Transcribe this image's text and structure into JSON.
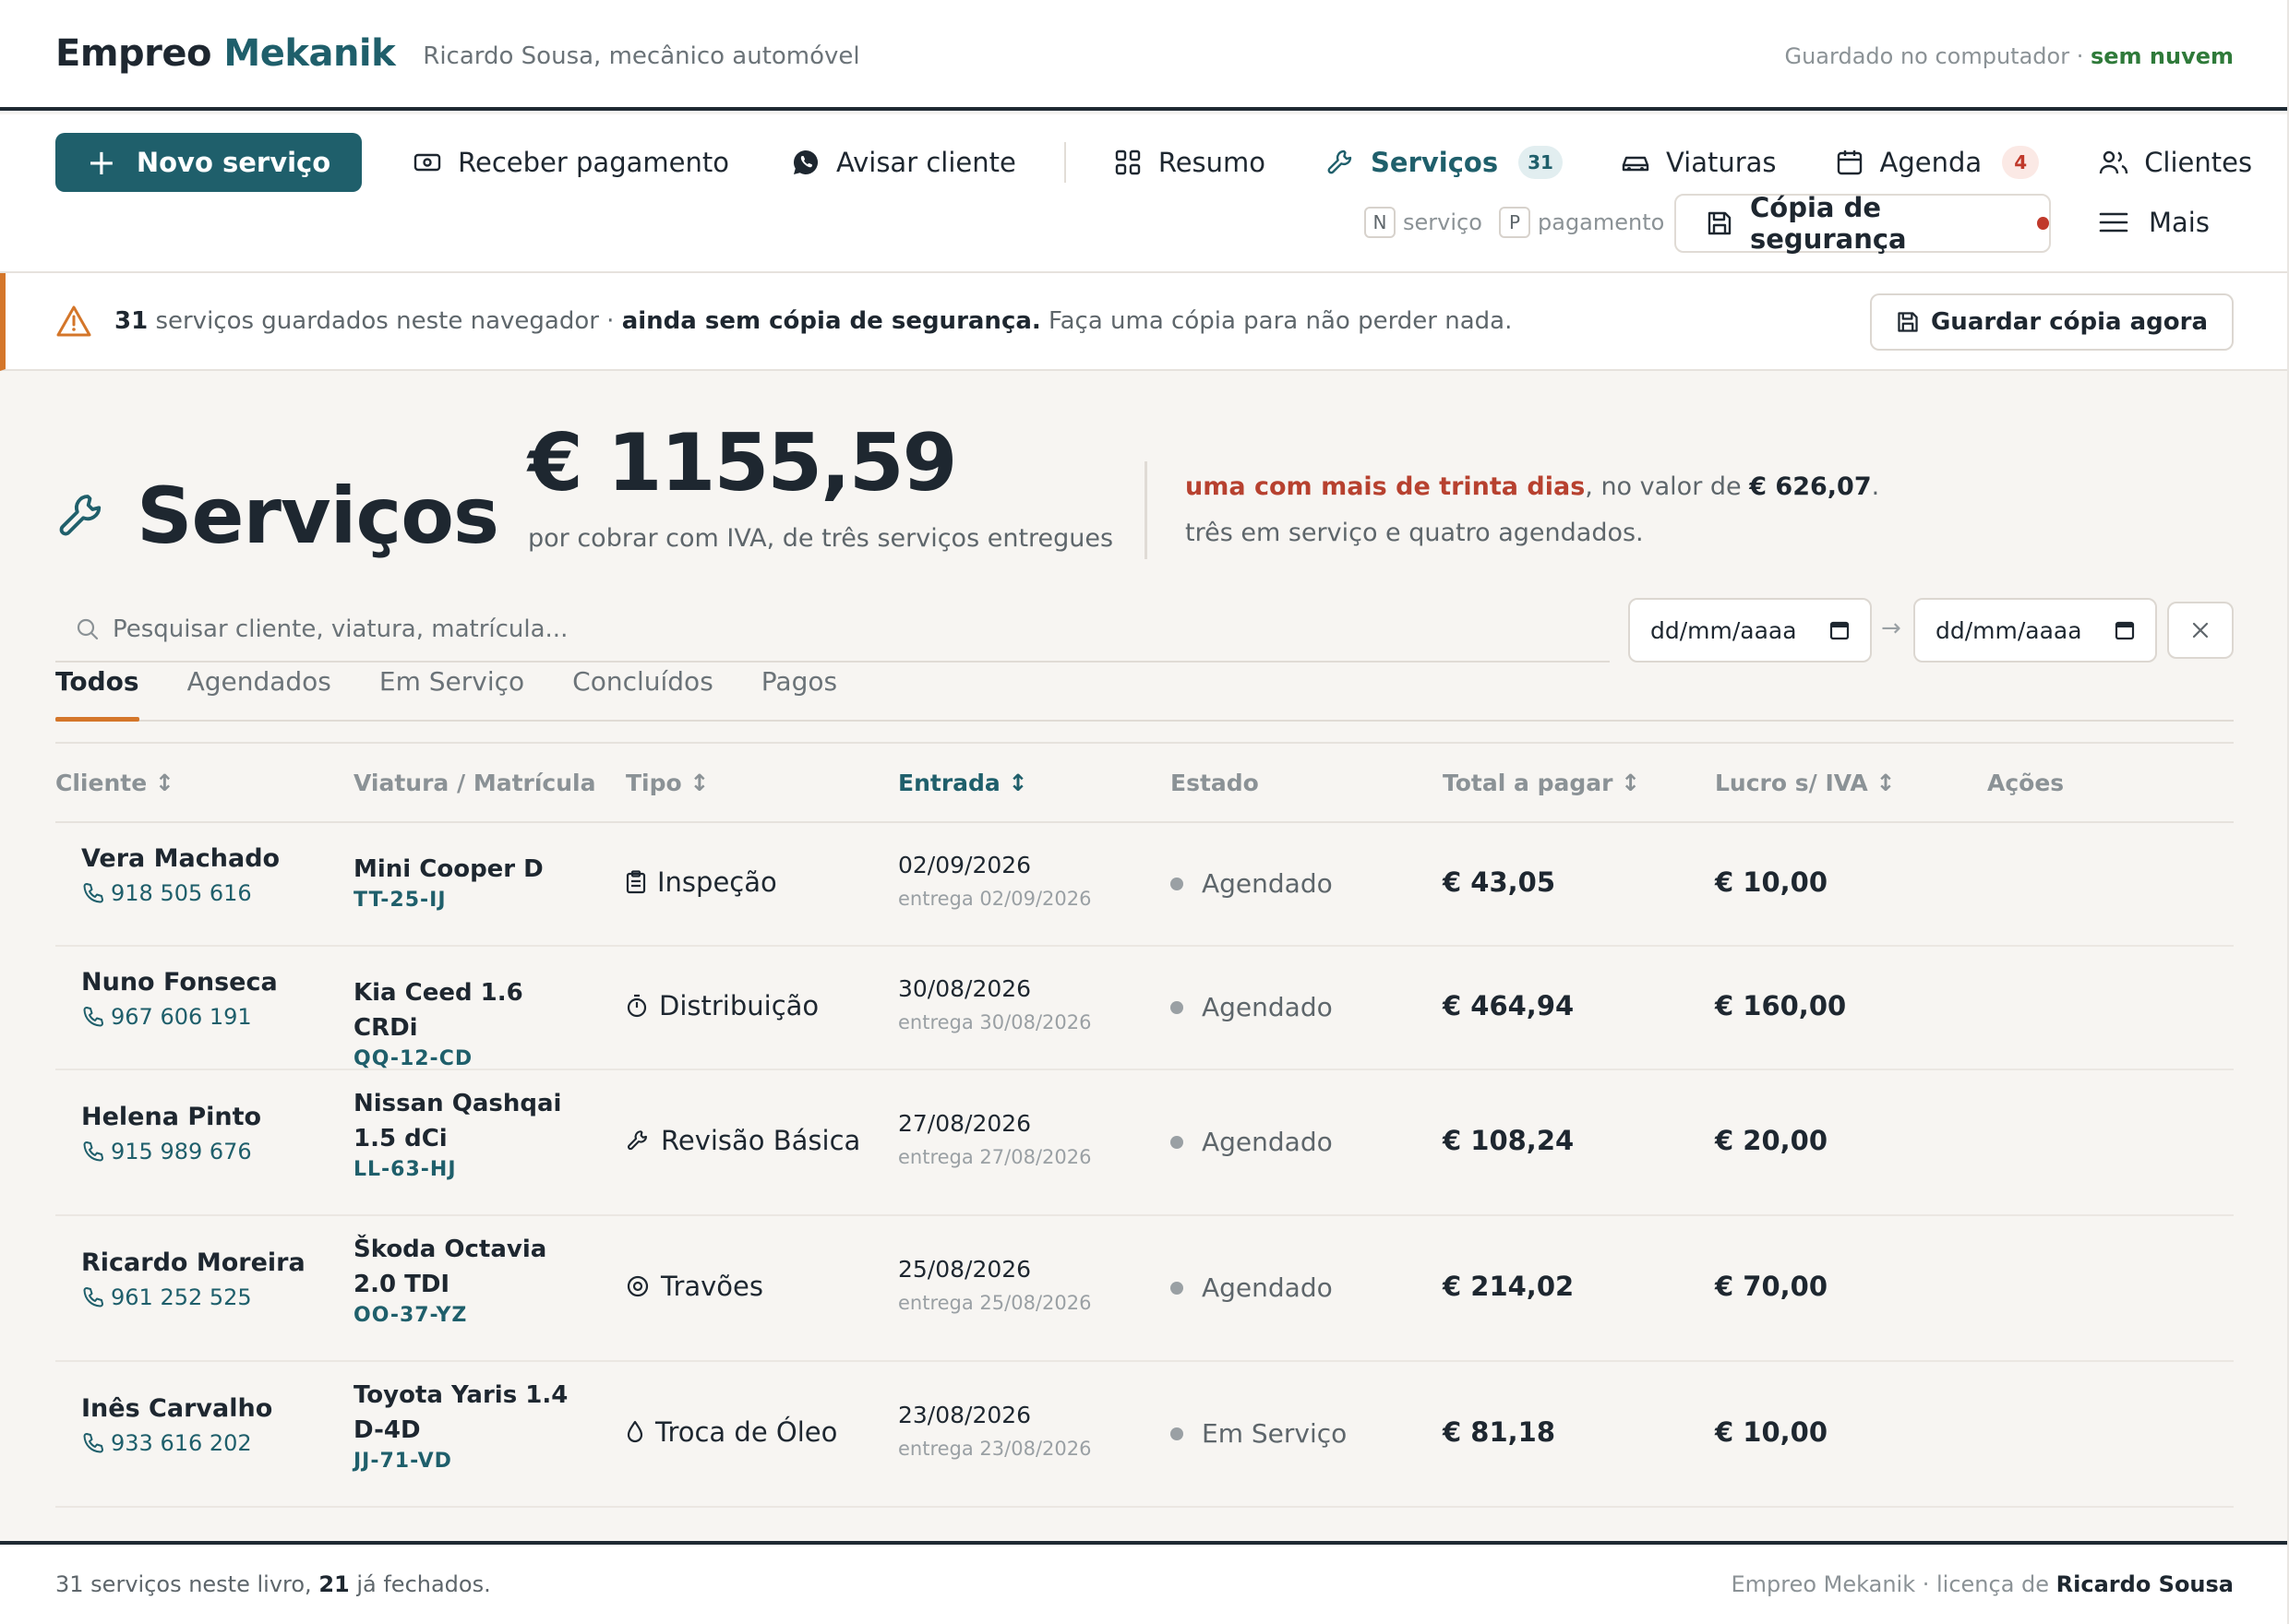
{
  "header": {
    "brand_main": "Empreo",
    "brand_accent": "Mekanik",
    "owner": "Ricardo Sousa, mecânico automóvel",
    "saved_prefix": "Guardado no computador · ",
    "saved_status": "sem nuvem"
  },
  "toolbar": {
    "new_service": "Novo serviço",
    "receive_payment": "Receber pagamento",
    "notify_client": "Avisar cliente",
    "summary": "Resumo",
    "services": "Serviços",
    "services_count": "31",
    "vehicles": "Viaturas",
    "agenda": "Agenda",
    "agenda_count": "4",
    "clients": "Clientes",
    "hint_n_key": "N",
    "hint_n_label": "serviço",
    "hint_p_key": "P",
    "hint_p_label": "pagamento",
    "backup": "Cópia de segurança",
    "more": "Mais"
  },
  "alert": {
    "count": "31",
    "text1": " serviços guardados neste navegador · ",
    "bold": "ainda sem cópia de segurança.",
    "text2": " Faça uma cópia para não perder nada.",
    "button": "Guardar cópia agora"
  },
  "hero": {
    "title": "Serviços",
    "amount": "€ 1155,59",
    "amount_sub": "por cobrar com IVA, de três serviços entregues",
    "note_warn": "uma com mais de trinta dias",
    "note_mid": ", no valor de ",
    "note_value": "€ 626,07",
    "note_end": ".",
    "note2": "três em serviço e quatro agendados."
  },
  "search": {
    "placeholder": "Pesquisar cliente, viatura, matrícula...",
    "date_from": "dd/mm/aaaa",
    "date_to": "dd/mm/aaaa",
    "arrow": "→"
  },
  "tabs": [
    "Todos",
    "Agendados",
    "Em Serviço",
    "Concluídos",
    "Pagos"
  ],
  "columns": {
    "client": "Cliente ↕",
    "vehicle": "Viatura / Matrícula",
    "type": "Tipo ↕",
    "entry": "Entrada ↕",
    "status": "Estado",
    "total": "Total a pagar ↕",
    "profit": "Lucro s/ IVA ↕",
    "actions": "Ações"
  },
  "rows": [
    {
      "client": "Vera Machado",
      "phone": "918 505 616",
      "vehicle": "Mini Cooper D",
      "plate": "TT-25-IJ",
      "type": "Inspeção",
      "type_icon": "clipboard-icon",
      "entry": "02/09/2026",
      "delivery": "entrega 02/09/2026",
      "status": "Agendado",
      "total": "€ 43,05",
      "profit": "€ 10,00"
    },
    {
      "client": "Nuno Fonseca",
      "phone": "967 606 191",
      "vehicle": "Kia Ceed 1.6 CRDi",
      "plate": "QQ-12-CD",
      "type": "Distribuição",
      "type_icon": "timer-icon",
      "entry": "30/08/2026",
      "delivery": "entrega 30/08/2026",
      "status": "Agendado",
      "total": "€ 464,94",
      "profit": "€ 160,00"
    },
    {
      "client": "Helena Pinto",
      "phone": "915 989 676",
      "vehicle": "Nissan Qashqai 1.5 dCi",
      "plate": "LL-63-HJ",
      "type": "Revisão Básica",
      "type_icon": "wrench-icon",
      "entry": "27/08/2026",
      "delivery": "entrega 27/08/2026",
      "status": "Agendado",
      "total": "€ 108,24",
      "profit": "€ 20,00"
    },
    {
      "client": "Ricardo Moreira",
      "phone": "961 252 525",
      "vehicle": "Škoda Octavia 2.0 TDI",
      "plate": "OO-37-YZ",
      "type": "Travões",
      "type_icon": "disc-icon",
      "entry": "25/08/2026",
      "delivery": "entrega 25/08/2026",
      "status": "Agendado",
      "total": "€ 214,02",
      "profit": "€ 70,00"
    },
    {
      "client": "Inês Carvalho",
      "phone": "933 616 202",
      "vehicle": "Toyota Yaris 1.4 D-4D",
      "plate": "JJ-71-VD",
      "type": "Troca de Óleo",
      "type_icon": "drop-icon",
      "entry": "23/08/2026",
      "delivery": "entrega 23/08/2026",
      "status": "Em Serviço",
      "total": "€ 81,18",
      "profit": "€ 10,00"
    }
  ],
  "footer": {
    "count": "31",
    "text1": " serviços neste livro, ",
    "closed": "21",
    "text2": " já fechados.",
    "license_prefix": "Empreo Mekanik · licença de ",
    "license_owner": "Ricardo Sousa"
  },
  "colors": {
    "brand": "#1f5f6b",
    "accent": "#d4762a",
    "danger": "#c0392b"
  }
}
